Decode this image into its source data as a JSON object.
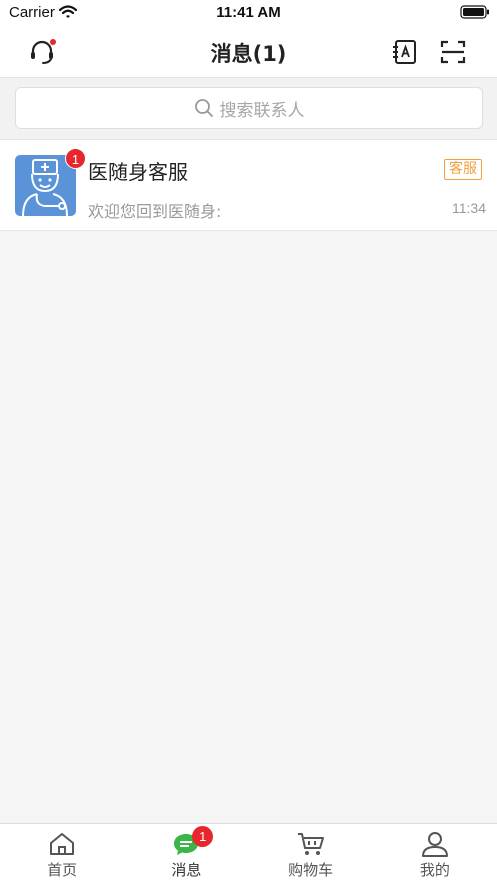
{
  "status_bar": {
    "carrier": "Carrier",
    "time": "11:41 AM"
  },
  "nav": {
    "title": "消息(1)"
  },
  "search": {
    "placeholder": "搜索联系人"
  },
  "conversations": [
    {
      "name": "医随身客服",
      "tag": "客服",
      "preview": "欢迎您回到医随身:",
      "time": "11:34",
      "unread": "1"
    }
  ],
  "tabs": [
    {
      "label": "首页",
      "icon": "home-icon"
    },
    {
      "label": "消息",
      "icon": "chat-bubble-icon",
      "badge": "1",
      "active": true
    },
    {
      "label": "购物车",
      "icon": "cart-icon"
    },
    {
      "label": "我的",
      "icon": "user-icon"
    }
  ],
  "colors": {
    "accent_green": "#3bb44a",
    "badge_red": "#e8262d",
    "tag_orange": "#f0a040",
    "avatar_blue": "#5b93d8"
  }
}
